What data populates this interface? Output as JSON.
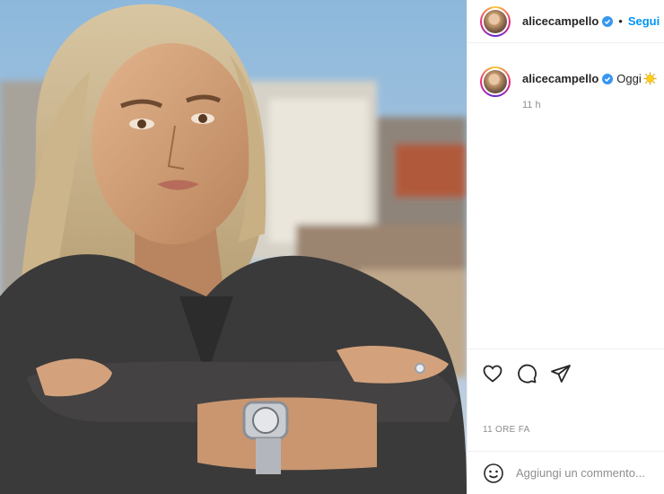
{
  "post": {
    "image_alt": "Photo of a woman with crossed arms wearing a dark denim jacket and a wristwatch, city rooftops in the background"
  },
  "header": {
    "username": "alicecampello",
    "dot": "•",
    "follow_label": "Segui"
  },
  "caption": {
    "username": "alicecampello",
    "text": "Oggi",
    "emoji_icon": "sun-icon",
    "time": "11 h"
  },
  "actions": {
    "like_icon": "heart-icon",
    "comment_icon": "comment-icon",
    "share_icon": "paper-plane-icon"
  },
  "timestamp": "11 ORE FA",
  "comment_box": {
    "emoji_icon": "smiley-icon",
    "placeholder": "Aggiungi un commento..."
  },
  "colors": {
    "link_blue": "#0095f6",
    "verified_blue": "#3897f0",
    "text": "#262626",
    "muted": "#8e8e8e"
  }
}
